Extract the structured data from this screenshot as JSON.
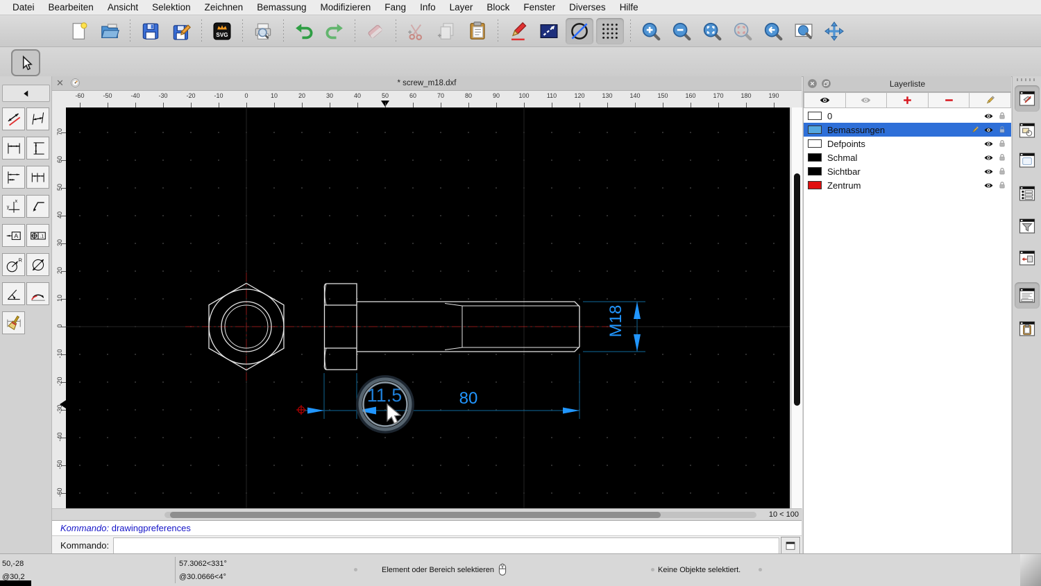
{
  "menubar": {
    "items": [
      "Datei",
      "Bearbeiten",
      "Ansicht",
      "Selektion",
      "Zeichnen",
      "Bemassung",
      "Modifizieren",
      "Fang",
      "Info",
      "Layer",
      "Block",
      "Fenster",
      "Diverses",
      "Hilfe"
    ]
  },
  "window": {
    "title": "* screw_m18.dxf"
  },
  "toolbar": {
    "groups": [
      [
        {
          "icon": "new-file"
        },
        {
          "icon": "open-folder"
        }
      ],
      [
        {
          "icon": "save"
        },
        {
          "icon": "save-as"
        }
      ],
      [
        {
          "icon": "svg-export"
        }
      ],
      [
        {
          "icon": "print-preview"
        }
      ],
      [
        {
          "icon": "undo"
        },
        {
          "icon": "redo"
        }
      ],
      [
        {
          "icon": "delete",
          "disabled": true
        }
      ],
      [
        {
          "icon": "cut",
          "disabled": true
        },
        {
          "icon": "copy",
          "disabled": true
        },
        {
          "icon": "paste"
        }
      ],
      [
        {
          "icon": "pen"
        },
        {
          "icon": "line-props"
        },
        {
          "icon": "reset",
          "pressed": true
        },
        {
          "icon": "grid",
          "pressed": true
        }
      ],
      [
        {
          "icon": "zoom-in"
        },
        {
          "icon": "zoom-out"
        },
        {
          "icon": "zoom-auto"
        },
        {
          "icon": "zoom-selection",
          "disabled": true
        },
        {
          "icon": "zoom-previous"
        },
        {
          "icon": "zoom-window"
        },
        {
          "icon": "pan"
        }
      ]
    ]
  },
  "tool_options": {
    "pointer_icon": "pointer"
  },
  "palette": {
    "back_icon": "back",
    "buttons": [
      "dim-aligned",
      "dim-linear",
      "dim-horizontal",
      "dim-vertical",
      "dim-baseline",
      "dim-continue",
      "dim-ordinate",
      "dim-leader",
      "dim-label",
      "dim-tolerance",
      "dim-radius",
      "dim-diameter",
      "dim-angular",
      "dim-arc",
      "dim-regen"
    ]
  },
  "rulers": {
    "h_values": [
      -60,
      -50,
      -40,
      -30,
      -20,
      -10,
      0,
      10,
      20,
      30,
      40,
      50,
      60,
      70,
      80,
      90,
      100,
      110,
      120,
      130,
      140,
      150,
      160,
      170,
      180,
      190
    ],
    "v_values": [
      70,
      60,
      50,
      40,
      30,
      20,
      10,
      0,
      -10,
      -20,
      -30,
      -40,
      -50,
      -60
    ],
    "h_marker_value": 50,
    "v_marker_value": -28
  },
  "canvas": {
    "dimensions": {
      "head_height": "11.5",
      "shank_length": "80",
      "thread": "M18"
    },
    "colors": {
      "dim_text": "#2196ff",
      "dim_line": "#0e557c",
      "centerline": "#8b1a1a",
      "entity": "#e6e6e6",
      "grid_dot": "#3d3d3d"
    }
  },
  "scroll": {
    "zoom_label": "10 < 100"
  },
  "command": {
    "history_label": "Kommando:",
    "history_value": "drawingpreferences",
    "prompt_label": "Kommando:",
    "input_value": ""
  },
  "layer_panel": {
    "title": "Layerliste",
    "buttons": [
      "eye",
      "eye-faded",
      "plus",
      "minus",
      "pencil"
    ],
    "layers": [
      {
        "name": "0",
        "color": "#ffffff",
        "selected": false
      },
      {
        "name": "Bemassungen",
        "color": "#55a8e0",
        "selected": true
      },
      {
        "name": "Defpoints",
        "color": "#ffffff",
        "selected": false
      },
      {
        "name": "Schmal",
        "color": "#000000",
        "selected": false
      },
      {
        "name": "Sichtbar",
        "color": "#000000",
        "selected": false
      },
      {
        "name": "Zentrum",
        "color": "#e01010",
        "selected": false
      }
    ]
  },
  "dock_strip": {
    "buttons": [
      {
        "icon": "dock-layers",
        "pressed": true
      },
      {
        "icon": "dock-blocks"
      },
      {
        "icon": "dock-views"
      },
      {
        "icon": "dock-properties"
      },
      {
        "icon": "dock-filter"
      },
      {
        "icon": "dock-library"
      },
      {
        "icon": "dock-command",
        "pressed": true
      },
      {
        "icon": "dock-clipboard"
      }
    ]
  },
  "status_bar": {
    "abs_coord": "50,-28",
    "rel_coord": "@30,2",
    "polar_abs": "57.3062<331°",
    "polar_rel": "@30.0666<4°",
    "hint": "Element oder Bereich selektieren",
    "selection": "Keine Objekte selektiert."
  }
}
